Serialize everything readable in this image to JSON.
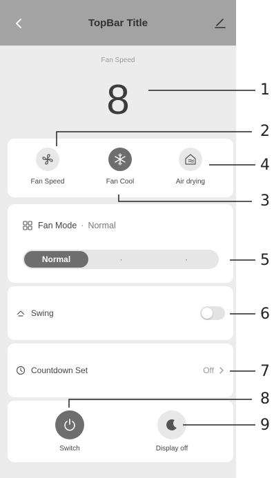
{
  "topbar": {
    "title": "TopBar Title"
  },
  "speed": {
    "label": "Fan Speed",
    "value": "8"
  },
  "functions": [
    {
      "label": "Fan Speed",
      "icon": "fan-icon"
    },
    {
      "label": "Fan Cool",
      "icon": "snowflake-icon"
    },
    {
      "label": "Air drying",
      "icon": "air-drying-icon"
    }
  ],
  "fan_mode": {
    "title": "Fan Mode",
    "separator": "·",
    "value": "Normal",
    "options": [
      "Normal",
      "·",
      "·"
    ]
  },
  "swing": {
    "label": "Swing",
    "state": "off"
  },
  "countdown": {
    "label": "Countdown Set",
    "value": "Off"
  },
  "bottom": [
    {
      "label": "Switch",
      "icon": "power-icon"
    },
    {
      "label": "Display off",
      "icon": "moon-icon"
    }
  ],
  "callouts": [
    "1",
    "2",
    "3",
    "4",
    "5",
    "6",
    "7",
    "8",
    "9"
  ],
  "colors": {
    "topbar": "#a3a3a3",
    "background": "#ececec",
    "card": "#ffffff",
    "active": "#6e6e6e"
  }
}
